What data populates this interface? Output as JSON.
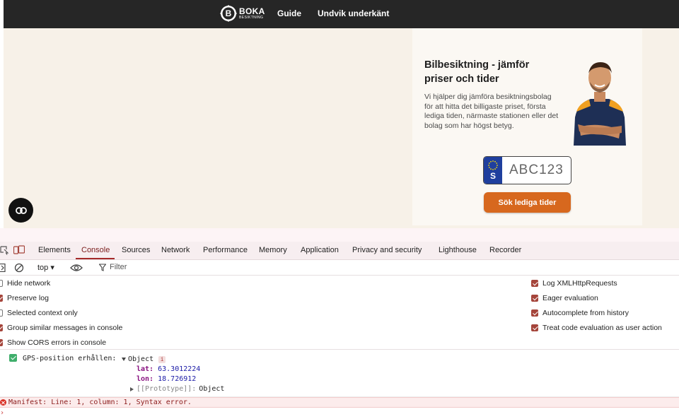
{
  "site": {
    "logo": {
      "main": "BOKA",
      "sub": "BESIKTNING"
    },
    "nav": [
      "Guide",
      "Undvik underkänt"
    ]
  },
  "hero": {
    "title": "Bilbesiktning - jämför priser och tider",
    "description": "Vi hjälper dig jämföra besiktningsbolag för att hitta det billigaste priset, första lediga tiden, närmaste stationen eller det bolag som har högst betyg.",
    "plate": {
      "country": "S",
      "number": "ABC123"
    },
    "cta_label": "Sök lediga tider",
    "accent_color": "#d7681e"
  },
  "floating_button": {
    "icon": "link-icon"
  },
  "devtools": {
    "tabs": [
      "Elements",
      "Console",
      "Sources",
      "Network",
      "Performance",
      "Memory",
      "Application",
      "Privacy and security",
      "Lighthouse",
      "Recorder"
    ],
    "active_tab": "Console",
    "toolbar": {
      "context": "top ▾",
      "filter_placeholder": "Filter"
    },
    "settings_left": [
      {
        "label": "Hide network",
        "checked": false
      },
      {
        "label": "Preserve log",
        "checked": true
      },
      {
        "label": "Selected context only",
        "checked": false
      },
      {
        "label": "Group similar messages in console",
        "checked": true
      },
      {
        "label": "Show CORS errors in console",
        "checked": true
      }
    ],
    "settings_right": [
      {
        "label": "Log XMLHttpRequests",
        "checked": true
      },
      {
        "label": "Eager evaluation",
        "checked": true
      },
      {
        "label": "Autocomplete from history",
        "checked": true
      },
      {
        "label": "Treat code evaluation as user action",
        "checked": true
      }
    ],
    "log": {
      "label": "GPS-position erhållen:",
      "object_label": "Object",
      "info_badge": "i",
      "props": [
        {
          "key": "lat:",
          "value": "63.3012224"
        },
        {
          "key": "lon:",
          "value": "18.726912"
        }
      ],
      "prototype_key": "[[Prototype]]:",
      "prototype_value": "Object"
    },
    "error": "Manifest: Line: 1, column: 1, Syntax error.",
    "prompt": "›"
  }
}
